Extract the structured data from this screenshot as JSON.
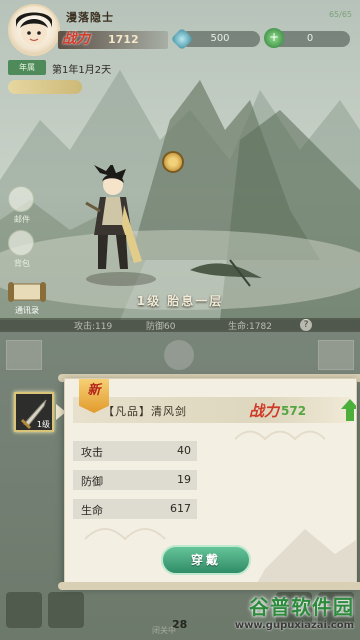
{
  "player": {
    "name": "漫落隐士",
    "power_icon": "战力",
    "power": "1712",
    "corner_stat": "65/65"
  },
  "currencies": [
    {
      "icon": "jade-diamond-icon",
      "value": "500"
    },
    {
      "icon": "green-coin-plus-icon",
      "value": "0"
    }
  ],
  "realm": {
    "tag": "年属",
    "date": "第1年1月2天",
    "progress_pill": ""
  },
  "side_buttons": [
    {
      "label": "邮件",
      "icon": "mail-icon"
    },
    {
      "label": "背包",
      "icon": "bag-icon"
    },
    {
      "label": "通讯录",
      "icon": "scroll-icon"
    }
  ],
  "hero": {
    "title": "1级 胎息一层"
  },
  "stats_band": {
    "attack": "攻击:119",
    "defense": "防御60",
    "hp": "生命:1782",
    "help": "?"
  },
  "item": {
    "level": "1级",
    "new_badge": "新",
    "name": "【凡品】清风剑",
    "power_icon": "战力",
    "power": "572",
    "stats": [
      {
        "key": "攻击",
        "value": "40"
      },
      {
        "key": "防御",
        "value": "19"
      },
      {
        "key": "生命",
        "value": "617"
      }
    ],
    "equip_label": "穿戴"
  },
  "bottom": {
    "number": "28",
    "label": "闭关中"
  },
  "watermark": {
    "main": "谷普软件园",
    "url": "www.gupuxiazai.com"
  },
  "colors": {
    "power_red": "#d63b2a",
    "power_green": "#55a542",
    "equip_green": "#2f8c66",
    "popup_bg": "#f3efe2"
  }
}
